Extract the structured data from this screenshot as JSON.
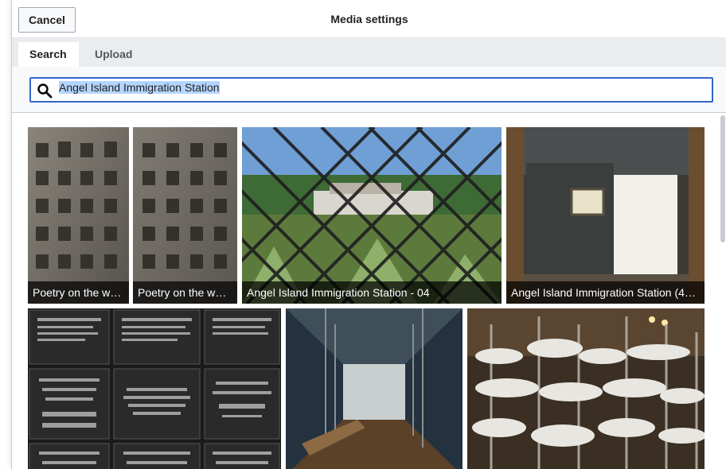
{
  "dialog": {
    "title": "Media settings",
    "cancel_label": "Cancel"
  },
  "tabs": [
    {
      "label": "Search",
      "active": true
    },
    {
      "label": "Upload",
      "active": false
    }
  ],
  "search": {
    "value": "Angel Island Immigration Station",
    "icon": "search-icon"
  },
  "results": [
    {
      "caption": "Poetry on the w…"
    },
    {
      "caption": "Poetry on the w…"
    },
    {
      "caption": "Angel Island Immigration Station - 04"
    },
    {
      "caption": "Angel Island Immigration Station (4…"
    },
    {
      "caption": ""
    },
    {
      "caption": ""
    },
    {
      "caption": ""
    }
  ],
  "colors": {
    "accent": "#3366cc",
    "tab_bar": "#eaecf0"
  }
}
